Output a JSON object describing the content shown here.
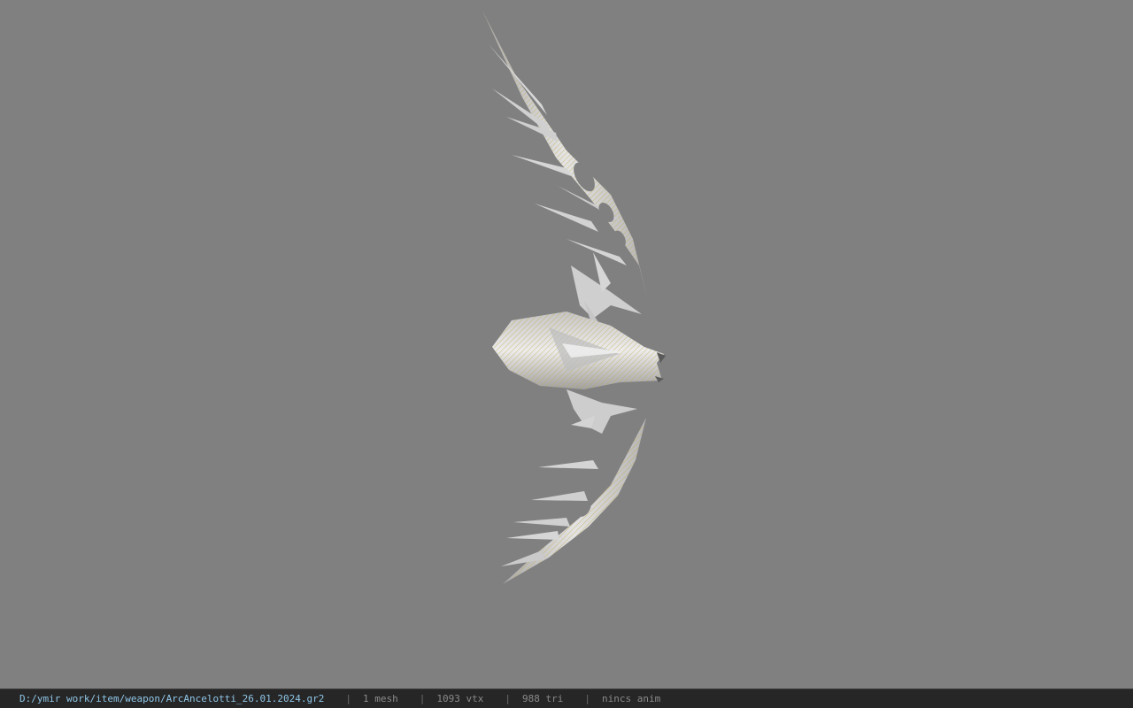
{
  "viewer": {
    "background_color": "#808080",
    "model_icon": "bow-weapon-model",
    "mesh_colors": {
      "base": "#d2d2d2",
      "shadow": "#9c9c9c",
      "highlight": "#f0f0f0",
      "gold": "#c8a948"
    }
  },
  "status_bar": {
    "file_path": "D:/ymir work/item/weapon/ArcAncelotti_26.01.2024.gr2",
    "separator": "|",
    "mesh_count": "1 mesh",
    "vertex_count": "1093 vtx",
    "triangle_count": "988 tri",
    "anim_status": "nincs anim",
    "colors": {
      "background": "#262626",
      "path": "#8fc6e8",
      "stat": "#8a8a8a"
    }
  }
}
